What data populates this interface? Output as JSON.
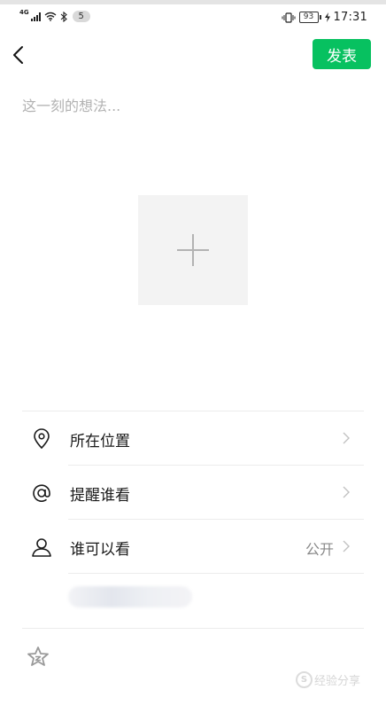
{
  "status_bar": {
    "network": "4G",
    "notification_count": "5",
    "battery": "93",
    "time": "17:31"
  },
  "header": {
    "back_icon": "chevron-left-icon",
    "publish_label": "发表"
  },
  "compose": {
    "placeholder": "这一刻的想法...",
    "add_photo_icon": "plus-icon"
  },
  "options": [
    {
      "icon": "location-pin-icon",
      "label": "所在位置",
      "value": ""
    },
    {
      "icon": "at-sign-icon",
      "label": "提醒谁看",
      "value": ""
    },
    {
      "icon": "person-icon",
      "label": "谁可以看",
      "value": "公开"
    }
  ],
  "blurred_row_text": "",
  "footer_icon": "star-icon",
  "watermark": {
    "text": "经验分享"
  },
  "colors": {
    "accent": "#07c160",
    "placeholder": "#b2b2b2",
    "divider": "#ececec",
    "photo_box": "#f3f3f3"
  }
}
